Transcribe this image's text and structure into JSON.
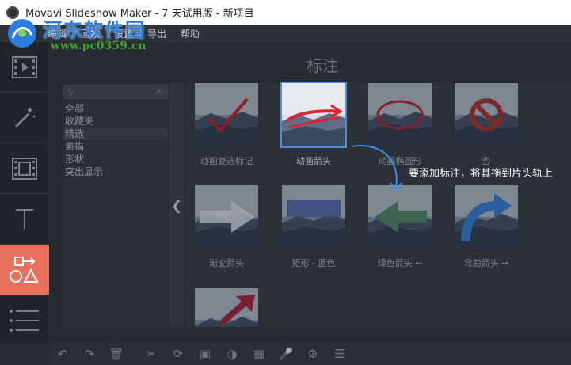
{
  "window": {
    "title": "Movavi Slideshow Maker - 7 天试用版 - 新项目"
  },
  "menu": [
    "编辑",
    "回放",
    "设置",
    "导出",
    "帮助"
  ],
  "watermark": {
    "text": "河东软件园",
    "url": "www.pc0359.cn"
  },
  "sidebar": [
    {
      "icon": "film-icon",
      "active": false
    },
    {
      "icon": "magic-wand-icon",
      "active": false
    },
    {
      "icon": "transition-icon",
      "active": false
    },
    {
      "icon": "text-icon",
      "active": false
    },
    {
      "icon": "shapes-icon",
      "active": true
    },
    {
      "icon": "list-icon",
      "active": false
    }
  ],
  "section": {
    "title": "标注"
  },
  "search": {
    "placeholder": ""
  },
  "categories": [
    {
      "label": "全部",
      "selected": false
    },
    {
      "label": "收藏夹",
      "selected": false
    },
    {
      "label": "精选",
      "selected": true
    },
    {
      "label": "素描",
      "selected": false
    },
    {
      "label": "形状",
      "selected": false
    },
    {
      "label": "突出显示",
      "selected": false
    }
  ],
  "tiles": [
    {
      "label": "动画复选标记",
      "selected": false
    },
    {
      "label": "动画箭头",
      "selected": true
    },
    {
      "label": "动画椭圆形",
      "selected": false
    },
    {
      "label": "否",
      "selected": false
    },
    {
      "label": "渐变箭头",
      "selected": false
    },
    {
      "label": "矩形 - 蓝色",
      "selected": false
    },
    {
      "label": "绿色箭头 ←",
      "selected": false
    },
    {
      "label": "弯曲箭头 →",
      "selected": false
    },
    {
      "label": "",
      "selected": false
    }
  ],
  "annotation": {
    "text": "要添加标注，将其拖到片头轨上"
  },
  "toolbar": [
    "undo-icon",
    "redo-icon",
    "trash-icon",
    "cut-icon",
    "rotate-icon",
    "crop-icon",
    "color-icon",
    "image-icon",
    "mic-icon",
    "gear-icon",
    "equalizer-icon"
  ]
}
